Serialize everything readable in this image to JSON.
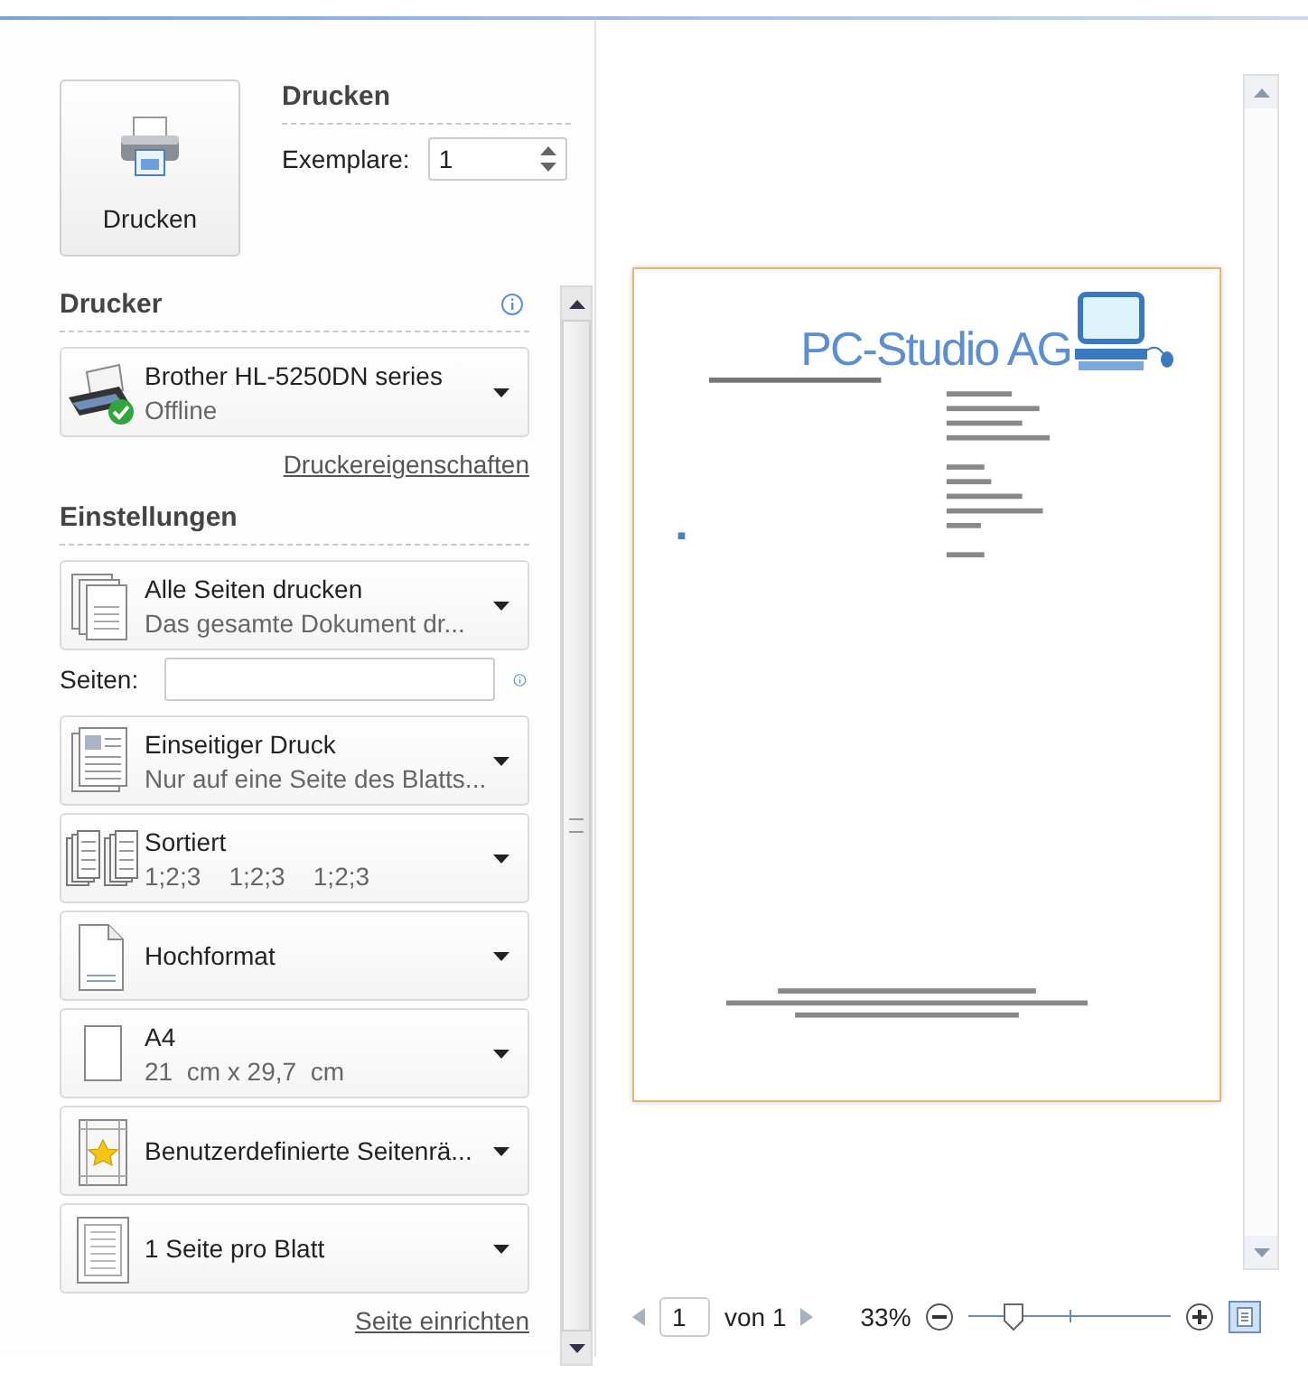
{
  "print_button": {
    "label": "Drucken"
  },
  "print_section": {
    "heading": "Drucken",
    "copies_label": "Exemplare:",
    "copies_value": "1"
  },
  "printer": {
    "heading": "Drucker",
    "name": "Brother HL-5250DN series",
    "status": "Offline",
    "properties_link": "Druckereigenschaften"
  },
  "settings": {
    "heading": "Einstellungen",
    "items": [
      {
        "kind": "dropdown",
        "title": "Alle Seiten drucken",
        "subtitle": "Das gesamte Dokument dr..."
      },
      {
        "kind": "field",
        "label": "Seiten:"
      },
      {
        "kind": "dropdown",
        "title": "Einseitiger Druck",
        "subtitle": "Nur auf eine Seite des Blatts..."
      },
      {
        "kind": "dropdown",
        "title": "Sortiert",
        "subtitle": "1;2;3    1;2;3    1;2;3"
      },
      {
        "kind": "dropdown",
        "title": "Hochformat"
      },
      {
        "kind": "dropdown",
        "title": "A4",
        "subtitle": "21  cm x 29,7  cm"
      },
      {
        "kind": "dropdown",
        "title": "Benutzerdefinierte Seitenrä..."
      },
      {
        "kind": "dropdown",
        "title": "1 Seite pro Blatt"
      }
    ],
    "page_setup_link": "Seite einrichten"
  },
  "preview": {
    "logo_text": "PC-Studio AG"
  },
  "navigation": {
    "page_value": "1",
    "page_total": "von 1",
    "zoom": "33%",
    "zoom_slider": {
      "level": 0.17
    }
  }
}
